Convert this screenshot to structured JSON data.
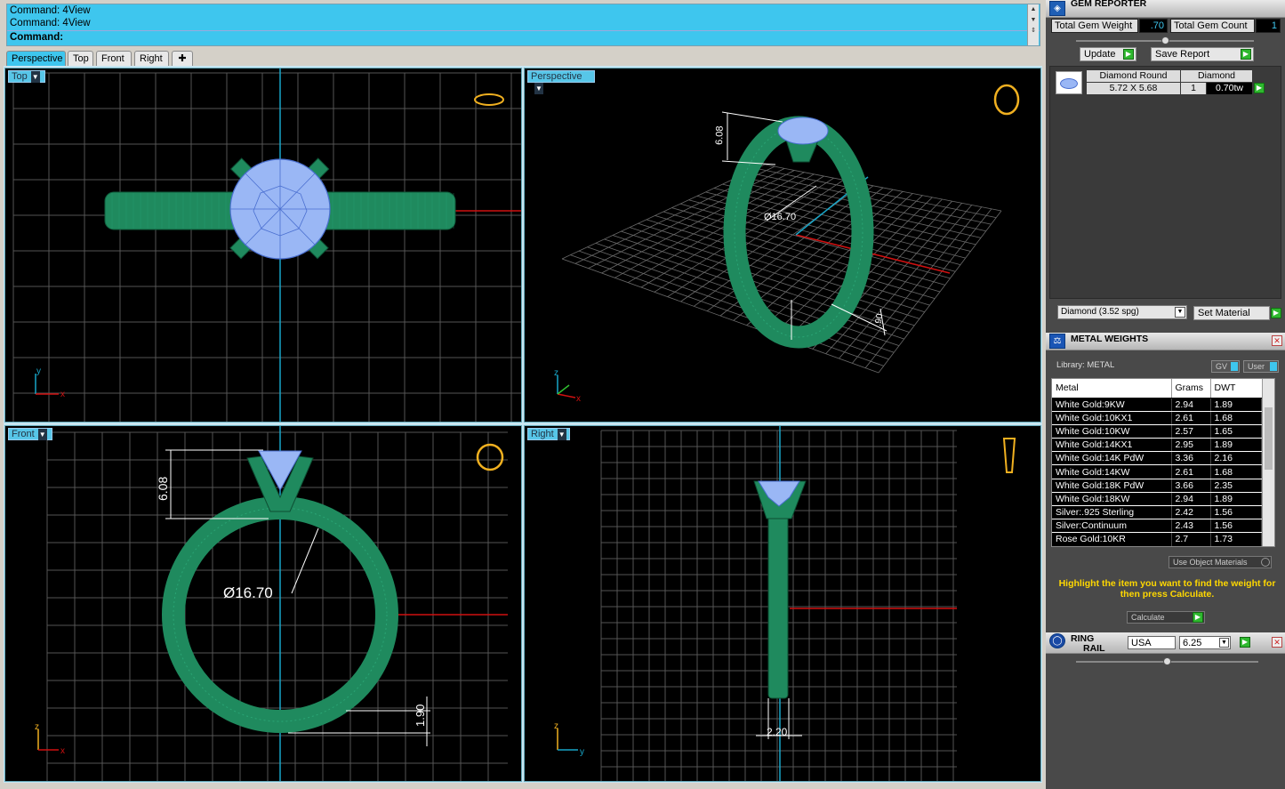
{
  "command_area": {
    "history": [
      "Command: 4View",
      "Command: 4View"
    ],
    "prompt_label": "Command:"
  },
  "view_tabs": [
    {
      "label": "Perspective",
      "active": true
    },
    {
      "label": "Top",
      "active": false
    },
    {
      "label": "Front",
      "active": false
    },
    {
      "label": "Right",
      "active": false
    }
  ],
  "viewports": {
    "top": {
      "label": "Top"
    },
    "perspective": {
      "label": "Perspective",
      "dim_height": "6.08",
      "dim_diameter": "Ø16.70",
      "dim_band": ".90"
    },
    "front": {
      "label": "Front",
      "dim_height": "6.08",
      "dim_diameter": "Ø16.70",
      "dim_band": "1.90"
    },
    "right": {
      "label": "Right",
      "dim_width": "2.20"
    }
  },
  "gem_reporter": {
    "title": "GEM REPORTER",
    "total_weight_label": "Total Gem Weight",
    "total_weight_value": ".70",
    "total_count_label": "Total Gem Count",
    "total_count_value": "1",
    "update_label": "Update",
    "save_report_label": "Save Report",
    "gem": {
      "name": "Diamond Round",
      "size": "5.72 X 5.68",
      "type": "Diamond",
      "count": "1",
      "weight": "0.70tw"
    },
    "material_select": "Diamond     (3.52 spg)",
    "set_material_label": "Set Material"
  },
  "metal_weights": {
    "title": "METAL WEIGHTS",
    "library_label": "Library: METAL",
    "gv_label": "GV",
    "user_label": "User",
    "columns": [
      "Metal",
      "Grams",
      "DWT"
    ],
    "rows": [
      [
        "White Gold:9KW",
        "2.94",
        "1.89"
      ],
      [
        "White Gold:10KX1",
        "2.61",
        "1.68"
      ],
      [
        "White Gold:10KW",
        "2.57",
        "1.65"
      ],
      [
        "White Gold:14KX1",
        "2.95",
        "1.89"
      ],
      [
        "White Gold:14K PdW",
        "3.36",
        "2.16"
      ],
      [
        "White Gold:14KW",
        "2.61",
        "1.68"
      ],
      [
        "White Gold:18K PdW",
        "3.66",
        "2.35"
      ],
      [
        "White Gold:18KW",
        "2.94",
        "1.89"
      ],
      [
        "Silver:.925 Sterling",
        "2.42",
        "1.56"
      ],
      [
        "Silver:Continuum",
        "2.43",
        "1.56"
      ],
      [
        "Rose Gold:10KR",
        "2.7",
        "1.73"
      ]
    ],
    "use_object_materials_label": "Use Object Materials",
    "note": "Highlight the item you want to find the weight for then press Calculate.",
    "calculate_label": "Calculate"
  },
  "ring_rail": {
    "title_line1": "RING",
    "title_line2": "RAIL",
    "standard": "USA",
    "size": "6.25"
  },
  "colors": {
    "command_bg": "#3ec6ee",
    "ring_green": "#1f8a5e",
    "gem_blue": "#9ab7f5",
    "axis_red": "#d01010",
    "axis_cyan": "#18a6c8"
  }
}
